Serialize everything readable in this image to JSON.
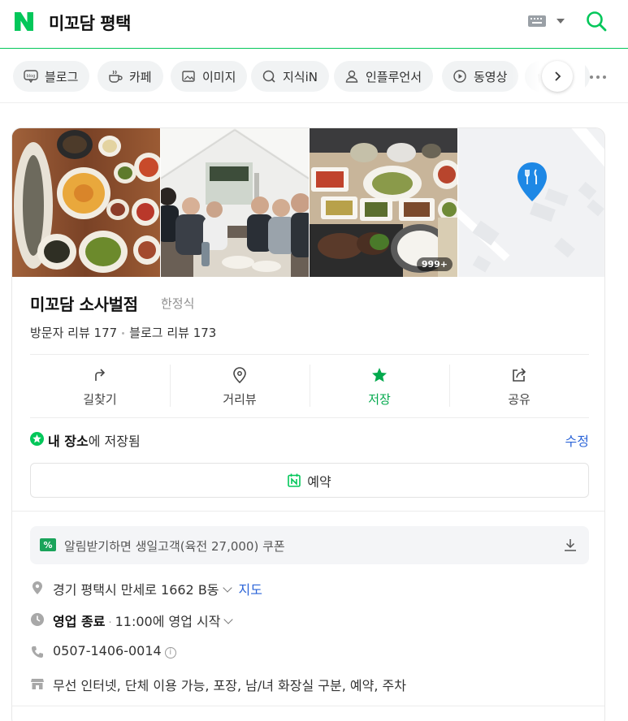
{
  "header": {
    "logo_letter": "N",
    "query": "미꼬담 평택",
    "brand_color": "#03c75a"
  },
  "tabs": [
    {
      "label": "블로그",
      "icon": "blog-icon"
    },
    {
      "label": "카페",
      "icon": "cafe-icon"
    },
    {
      "label": "이미지",
      "icon": "image-icon"
    },
    {
      "label": "지식iN",
      "icon": "kin-icon"
    },
    {
      "label": "인플루언서",
      "icon": "person-icon"
    },
    {
      "label": "동영상",
      "icon": "video-icon"
    },
    {
      "label": "",
      "icon": "shopping-icon"
    }
  ],
  "place": {
    "name": "미꼬담 소사벌점",
    "category": "한정식",
    "photo_count_badge": "999+",
    "reviews": {
      "visitor": "방문자 리뷰 177",
      "blog": "블로그 리뷰 173"
    },
    "actions": [
      {
        "label": "길찾기",
        "icon": "directions-icon"
      },
      {
        "label": "거리뷰",
        "icon": "street-view-icon"
      },
      {
        "label": "저장",
        "icon": "star-icon"
      },
      {
        "label": "공유",
        "icon": "share-icon"
      }
    ],
    "saved": {
      "bold": "내 장소",
      "rest": "에 저장됨",
      "edit": "수정"
    },
    "reserve_label": "예약",
    "coupon_text": "알림받기하면 생일고객(육전 27,000) 쿠폰",
    "address": "경기 평택시 만세로 1662 B동",
    "map_link": "지도",
    "hours": {
      "status": "영업 종료",
      "detail": "11:00에 영업 시작"
    },
    "phone": "0507-1406-0014",
    "amenities": "무선 인터넷, 단체 이용 가능, 포장, 남/녀 화장실 구분, 예약, 주차",
    "accent_color": "#03c75a",
    "link_color": "#2c65d8"
  }
}
